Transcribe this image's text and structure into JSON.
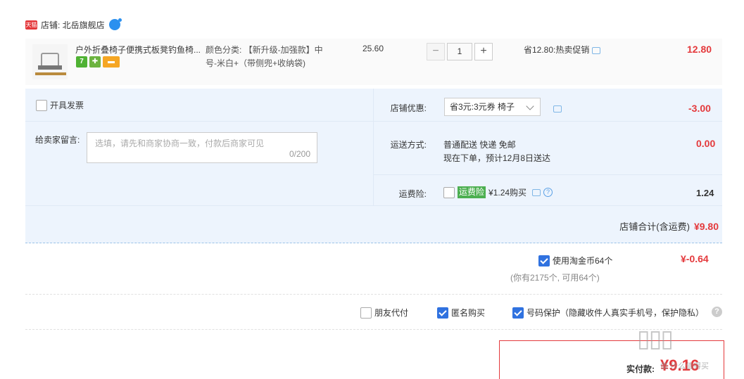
{
  "shop": {
    "tmall_logo": "天猫",
    "label": "店铺: 北岳旗舰店",
    "chat_badge": "♀"
  },
  "item": {
    "title": "户外折叠椅子便携式板凳钓鱼椅...",
    "sku_line1": "颜色分类: 【新升级-加强款】中",
    "sku_line2": "号-米白+（带侧兜+收纳袋)",
    "price": "25.60",
    "quantity": "1",
    "minus": "−",
    "plus": "+",
    "promo": "省12.80:热卖促销",
    "total": "12.80",
    "badge_seven": "7"
  },
  "extras": {
    "invoice_label": "开具发票",
    "memo_label": "给卖家留言:",
    "memo_placeholder": "选填，请先和商家协商一致，付款后商家可见",
    "memo_count": "0/200",
    "discount_label": "店铺优惠:",
    "discount_value": "省3元:3元券 椅子",
    "discount_amount": "-3.00",
    "shipping_label": "运送方式:",
    "shipping_line1": "普通配送 快递 免邮",
    "shipping_line2": "现在下单，预计12月8日送达",
    "shipping_amount": "0.00",
    "insurance_label": "运费险:",
    "insurance_tag": "运费险",
    "insurance_price": "¥1.24购买",
    "insurance_amount": "1.24",
    "shop_total_label": "店铺合计(含运费)",
    "shop_total": "¥9.80"
  },
  "coins": {
    "label": "使用淘金币64个",
    "amount": "¥-0.64",
    "note": "(你有2175个, 可用64个)"
  },
  "options": {
    "friend_pay": "朋友代付",
    "anonymous": "匿名购买",
    "number_protect": "号码保护（隐藏收件人真实手机号，保护隐私）",
    "help": "?"
  },
  "payment": {
    "label": "实付款:",
    "amount": "¥9.16"
  },
  "watermark": "值 什么值得买"
}
